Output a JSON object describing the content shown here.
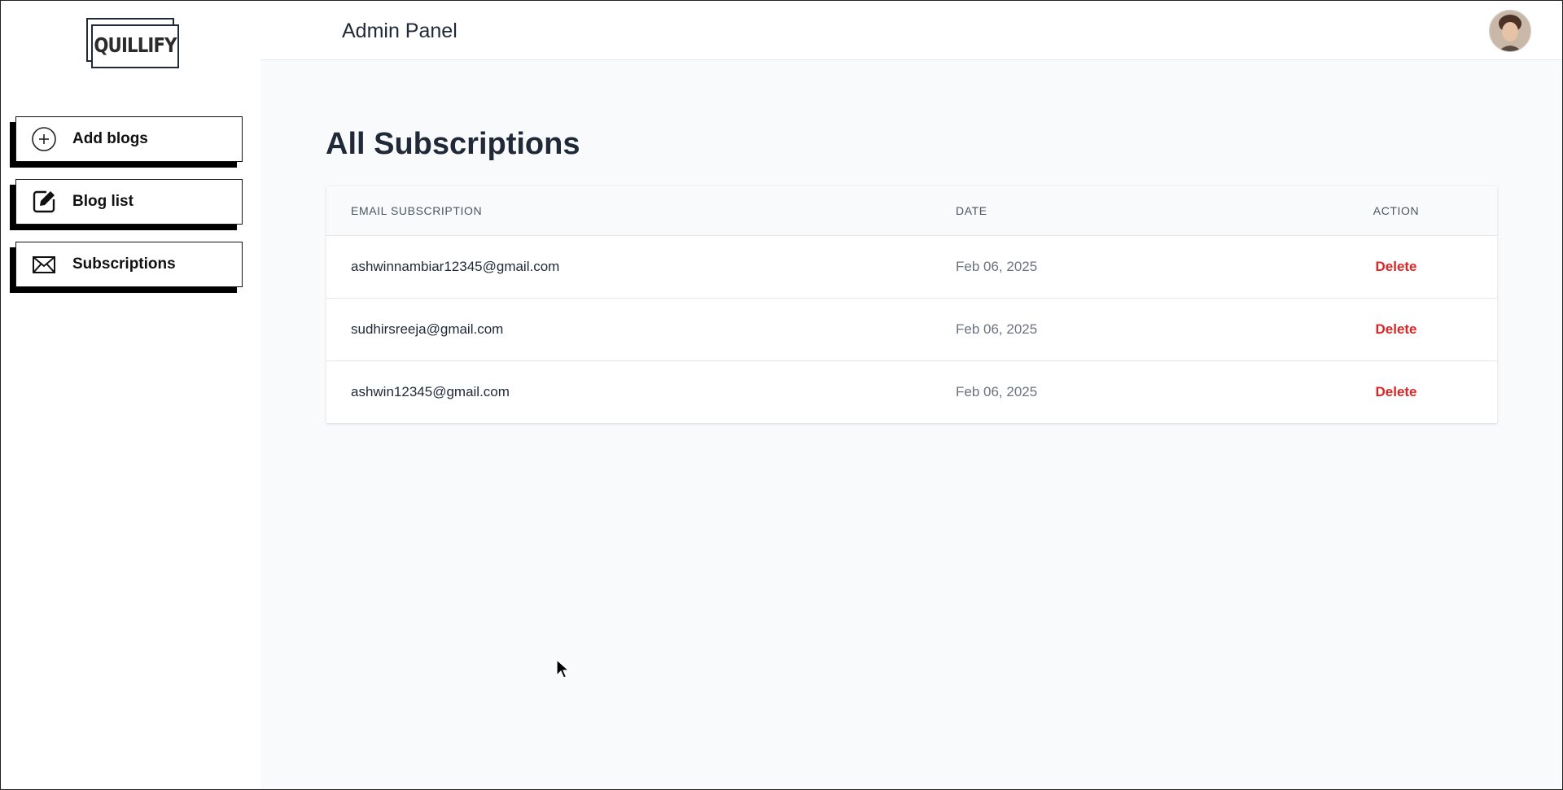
{
  "app": {
    "logo_text": "QUILLIFY",
    "panel_title": "Admin Panel"
  },
  "sidebar": {
    "items": [
      {
        "label": "Add blogs",
        "icon": "plus-circle-icon"
      },
      {
        "label": "Blog list",
        "icon": "edit-icon"
      },
      {
        "label": "Subscriptions",
        "icon": "mail-icon"
      }
    ]
  },
  "main": {
    "heading": "All Subscriptions",
    "table": {
      "columns": [
        "Email subscription",
        "Date",
        "Action"
      ],
      "rows": [
        {
          "email": "ashwinnambiar12345@gmail.com",
          "date": "Feb 06, 2025",
          "action": "Delete"
        },
        {
          "email": "sudhirsreeja@gmail.com",
          "date": "Feb 06, 2025",
          "action": "Delete"
        },
        {
          "email": "ashwin12345@gmail.com",
          "date": "Feb 06, 2025",
          "action": "Delete"
        }
      ]
    }
  },
  "colors": {
    "accent_delete": "#dc2626",
    "main_bg": "#f9fafb",
    "text_dark": "#1f2937"
  }
}
